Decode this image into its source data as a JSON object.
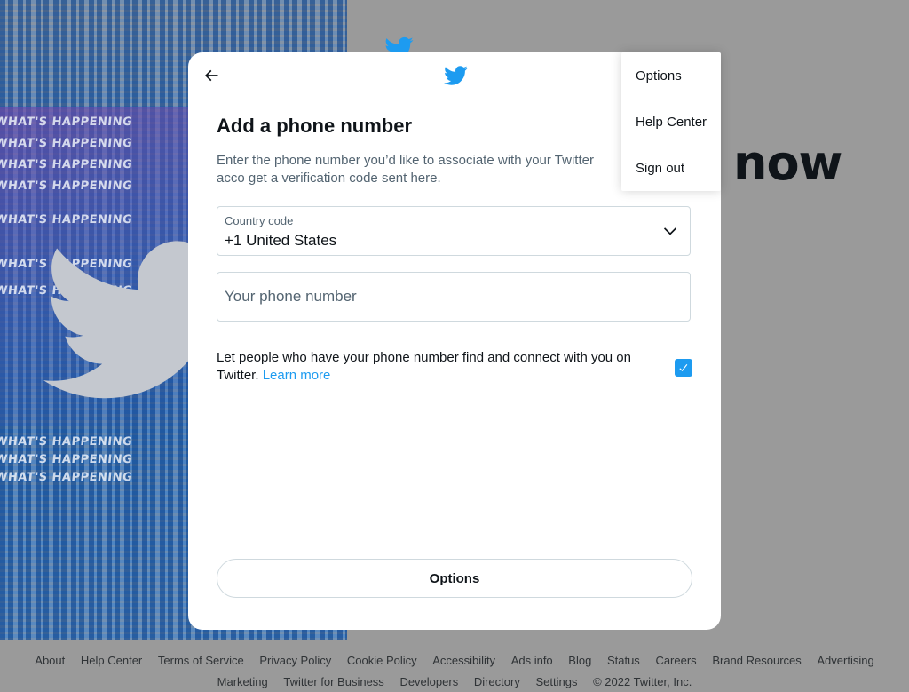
{
  "background": {
    "headline_fragment": "now",
    "poster_text": "WHAT'S HAPPENING"
  },
  "modal": {
    "title": "Add a phone number",
    "subtitle": "Enter the phone number you’d like to associate with your Twitter acco get a verification code sent here.",
    "country_label": "Country code",
    "country_value": "+1 United States",
    "phone_placeholder": "Your phone number",
    "discover_text": "Let people who have your phone number find and connect with you on Twitter.",
    "learn_more": "Learn more",
    "discover_checked": true,
    "options_button": "Options"
  },
  "menu": {
    "items": [
      "Options",
      "Help Center",
      "Sign out"
    ]
  },
  "footer": {
    "links": [
      "About",
      "Help Center",
      "Terms of Service",
      "Privacy Policy",
      "Cookie Policy",
      "Accessibility",
      "Ads info",
      "Blog",
      "Status",
      "Careers",
      "Brand Resources",
      "Advertising"
    ],
    "links_row2": [
      "Marketing",
      "Twitter for Business",
      "Developers",
      "Directory",
      "Settings",
      "© 2022 Twitter, Inc."
    ]
  },
  "colors": {
    "accent": "#1d9bf0",
    "text": "#0f1419",
    "muted": "#536471"
  },
  "icons": {
    "back": "arrow-left-icon",
    "logo": "twitter-bird-icon",
    "chevron": "chevron-down-icon",
    "check": "checkmark-icon"
  }
}
